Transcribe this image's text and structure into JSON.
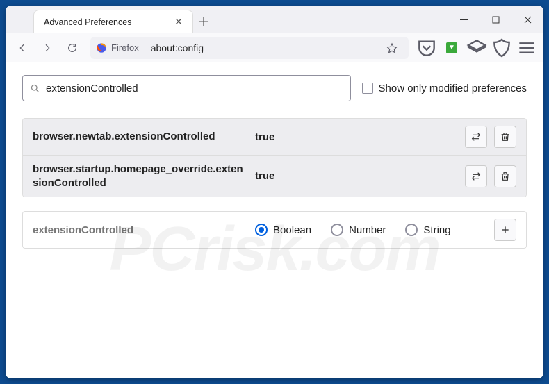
{
  "tab": {
    "title": "Advanced Preferences"
  },
  "urlbar": {
    "identity": "Firefox",
    "url": "about:config"
  },
  "search": {
    "value": "extensionControlled"
  },
  "filter": {
    "label": "Show only modified preferences"
  },
  "prefs": [
    {
      "name": "browser.newtab.extensionControlled",
      "value": "true"
    },
    {
      "name": "browser.startup.homepage_override.extensionControlled",
      "value": "true"
    }
  ],
  "newpref": {
    "name": "extensionControlled",
    "types": {
      "boolean": "Boolean",
      "number": "Number",
      "string": "String"
    }
  },
  "watermark": "PCrisk.com"
}
